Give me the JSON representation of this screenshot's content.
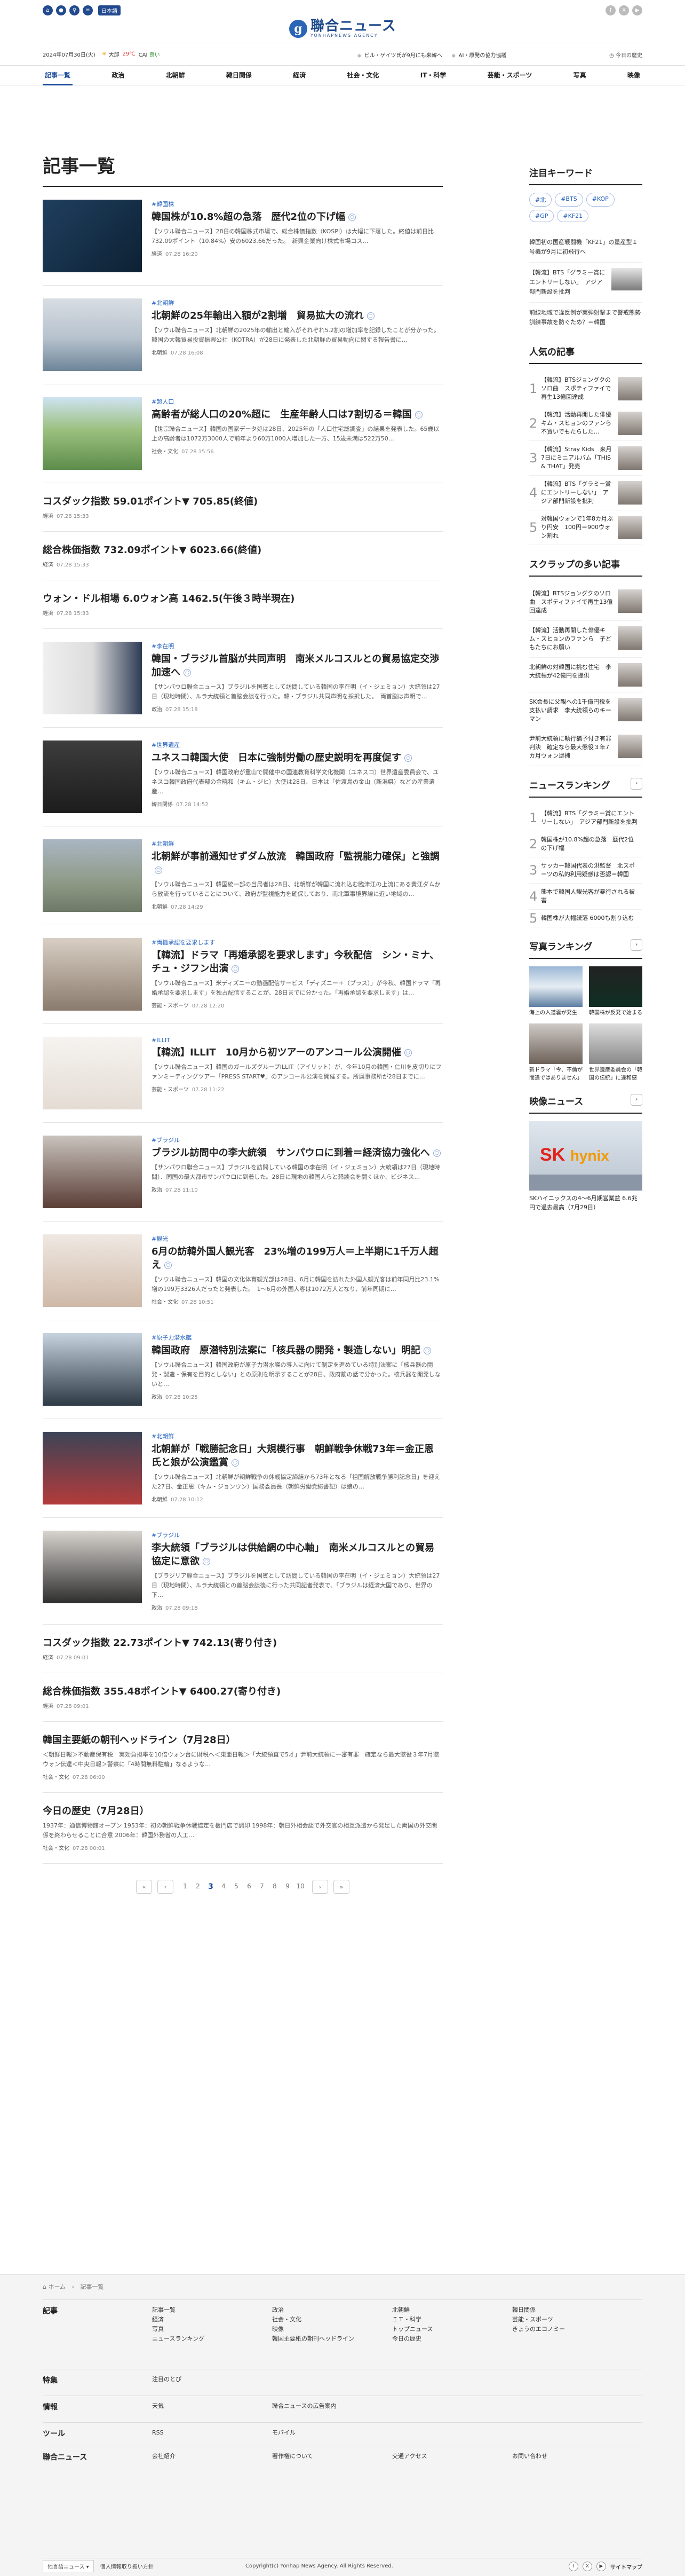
{
  "header": {
    "lang": "日本語",
    "logo_jp": "聯合ニュース",
    "logo_en": "YONHAPNEWS AGENCY",
    "date": "2024年07月30日(火)",
    "weather": "大邱",
    "temp": "29℃",
    "dust_label": "CAI",
    "dust_value": "良い",
    "ticker": [
      "ビル・ゲイツ氏が9月にも来韓へ",
      "AI・原発の協力協議"
    ],
    "history": "今日の歴史"
  },
  "nav": [
    "記事一覧",
    "政治",
    "北朝鮮",
    "韓日関係",
    "経済",
    "社会・文化",
    "IT・科学",
    "芸能・スポーツ",
    "写真",
    "映像"
  ],
  "main": {
    "title": "記事一覧",
    "articles": [
      {
        "cat": "#韓国株",
        "title": "韓国株が10.8%超の急落　歴代2位の下げ幅",
        "summary": "【ソウル聯合ニュース】28日の韓国株式市場で、総合株価指数（KOSPI）は大幅に下落した。終値は前日比732.09ポイント（10.84%）安の6023.66だった。　新興企業向け株式市場コス…",
        "tag": "経済",
        "time": "07.28 16:20",
        "thumb": "stock"
      },
      {
        "cat": "#北朝鮮",
        "title": "北朝鮮の25年輸出入額が2割増　貿易拡大の流れ",
        "summary": "【ソウル聯合ニュース】北朝鮮の2025年の輸出と輸入がそれぞれ5.2割の増加率を記録したことが分かった。　韓国の大韓貿易投資振興公社（KOTRA）が28日に発表した北朝鮮の貿易動向に関する報告書に…",
        "tag": "北朝鮮",
        "time": "07.28 16:08",
        "thumb": "port"
      },
      {
        "cat": "#超人口",
        "title": "高齢者が総人口の20%超に　生産年齢人口は7割切る＝韓国",
        "summary": "【世宗聯合ニュース】韓国の国家データ処は28日、2025年の「人口住宅総調査」の結果を発表した。65歳以上の高齢者は1072万3000人で前年より60万1000人増加した一方、15歳未満は522万50…",
        "tag": "社会・文化",
        "time": "07.28 15:56",
        "thumb": "park"
      }
    ],
    "plain1": [
      {
        "title": "コスダック指数 59.01ポイント▼ 705.85(終値)",
        "tag": "経済",
        "time": "07.28 15:33"
      },
      {
        "title": "総合株価指数 732.09ポイント▼ 6023.66(終値)",
        "tag": "経済",
        "time": "07.28 15:33"
      },
      {
        "title": "ウォン・ドル相場 6.0ウォン高 1462.5(午後３時半現在)",
        "tag": "経済",
        "time": "07.28 15:33"
      }
    ],
    "articles2": [
      {
        "cat": "#李在明",
        "title": "韓国・ブラジル首脳が共同声明　南米メルコスルとの貿易協定交渉加速へ",
        "summary": "【サンパウロ聯合ニュース】ブラジルを国賓として訪問している韓国の李在明（イ・ジェミョン）大統領は27日（現地時間）、ルラ大統領と首脳会談を行った。韓・ブラジル共同声明を採択した。　両首脳は声明で…",
        "tag": "政治",
        "time": "07.28 15:18",
        "thumb": "leaders"
      },
      {
        "cat": "#世界遺産",
        "title": "ユネスコ韓国大使　日本に強制労働の歴史説明を再度促す",
        "summary": "【ソウル聯合ニュース】韓国政府が重山で開催中の国連教育科学文化機関（ユネスコ）世界遺産委員会で、ユネスコ韓国政府代表部の金暁和（キム・ジヒ）大使は28日、日本は「佐渡島の金山（新潟県）などの産業遺産…",
        "tag": "韓日関係",
        "time": "07.28 14:52",
        "thumb": "speaker"
      },
      {
        "cat": "#北朝鮮",
        "title": "北朝鮮が事前通知せずダム放流　韓国政府「監視能力確保」と強調",
        "summary": "【ソウル聯合ニュース】韓国統一部の当局者は28日、北朝鮮が韓国に流れ込む臨津江の上流にある黄江ダムから放流を行っていることについて、政府が監視能力を確保しており、南北軍事境界線に近い地域の…",
        "tag": "北朝鮮",
        "time": "07.28 14:29",
        "thumb": "dam"
      },
      {
        "cat": "#両機承認を要求します",
        "title": "【韓流】ドラマ「再婚承認を要求します」今秋配信　シン・ミナ、チュ・ジフン出演",
        "summary": "【ソウル聯合ニュース】米ディズニーの動画配信サービス「ディズニー＋（プラス）」が今秋、韓国ドラマ「再婚承認を要求します」を独占配信することが、28日までに分かった。「再婚承認を要求します」は…",
        "tag": "芸能・スポーツ",
        "time": "07.28 12:20",
        "thumb": "couple"
      },
      {
        "cat": "#ILLIT",
        "title": "【韓流】ILLIT　10月から初ツアーのアンコール公演開催",
        "summary": "【ソウル聯合ニュース】韓国のガールズグループILLIT（アイリット）が、今年10月の韓国・仁川を皮切りにファンミーティングツアー「PRESS START♥」のアンコール公演を開催する。所属事務所が28日までに…",
        "tag": "芸能・スポーツ",
        "time": "07.28 11:22",
        "thumb": "group"
      },
      {
        "cat": "#ブラジル",
        "title": "ブラジル訪問中の李大統領　サンパウロに到着＝経済協力強化へ",
        "summary": "【サンパウロ聯合ニュース】ブラジルを訪問している韓国の李在明（イ・ジェミョン）大統領は27日（現地時間）、同国の最大都市サンパウロに到着した。28日に現地の韓国人らと懇談会を開くほか、ビジネス…",
        "tag": "政治",
        "time": "07.28 11:10",
        "thumb": "plane"
      },
      {
        "cat": "#観光",
        "title": "6月の訪韓外国人観光客　23%増の199万人＝上半期に1千万人超え",
        "summary": "【ソウル聯合ニュース】韓国の文化体育観光部は28日、6月に韓国を訪れた外国人観光客は前年同月比23.1%増の199万3326人だったと発表した。　1～6月の外国人客は1072万人となり、前年同期に…",
        "tag": "社会・文化",
        "time": "07.28 10:51",
        "thumb": "tourists"
      },
      {
        "cat": "#原子力潜水艦",
        "title": "韓国政府　原潜特別法案に「核兵器の開発・製造しない」明記",
        "summary": "【ソウル聯合ニュース】韓国政府が原子力潜水艦の導入に向けて制定を進めている特別法案に「核兵器の開発・製造・保有を目的としない」との原則を明示することが28日、政府筋の話で分かった。核兵器を開発しないと…",
        "tag": "政治",
        "time": "07.28 10:25",
        "thumb": "sub"
      },
      {
        "cat": "#北朝鮮",
        "title": "北朝鮮が「戦勝記念日」大規模行事　朝鮮戦争休戦73年＝金正恩氏と娘が公演鑑賞",
        "summary": "【ソウル聯合ニュース】北朝鮮が朝鮮戦争の休戦協定締結から73年となる「祖国解放戦争勝利記念日」を迎えた27日、金正恩（キム・ジョンウン）国務委員長（朝鮮労働党総書記）は娘の…",
        "tag": "北朝鮮",
        "time": "07.28 10:12",
        "thumb": "stage"
      },
      {
        "cat": "#ブラジル",
        "title": "李大統領「ブラジルは供給網の中心軸」　南米メルコスルとの貿易協定に意欲",
        "summary": "【ブラジリア聯合ニュース】ブラジルを国賓として訪問している韓国の李在明（イ・ジェミョン）大統領は27日（現地時間）、ルラ大統領との首脳会談後に行った共同記者発表で、「ブラジルは経済大国であり、世界の下…",
        "tag": "政治",
        "time": "07.28 09:18",
        "thumb": "podium"
      }
    ],
    "plain2": [
      {
        "title": "コスダック指数 22.73ポイント▼ 742.13(寄り付き)",
        "tag": "経済",
        "time": "07.28 09:01"
      },
      {
        "title": "総合株価指数 355.48ポイント▼ 6400.27(寄り付き)",
        "tag": "経済",
        "time": "07.28 09:01"
      }
    ],
    "plain3": [
      {
        "title": "韓国主要紙の朝刊ヘッドライン（7月28日）",
        "summary": "＜朝鮮日報＞不動産保有税　実効負担率を10倍ウォン台に財税へ＜東亜日報＞「大統領直で5才」尹前大統領に一審有罪　確定なら最大懲役３年7月懲ウォン伝達＜中央日報＞警察に「4時間無料駐輪」なるような…",
        "tag": "社会・文化",
        "time": "07.28 06:00"
      },
      {
        "title": "今日の歴史（7月28日）",
        "summary": "1937年：通信博物館オープン 1953年：初の朝鮮戦争休戦協定を板門店で調印 1998年：朝日外相会談で外交官の相互派遣から発足した両国の外交関係を終わらせることに合意 2006年：韓国外務省の人工…",
        "tag": "社会・文化",
        "time": "07.28 00:01"
      }
    ],
    "pages": [
      "1",
      "2",
      "3",
      "4",
      "5",
      "6",
      "7",
      "8",
      "9",
      "10"
    ],
    "current_page": "3"
  },
  "side": {
    "kw_title": "注目キーワード",
    "tags": [
      "#北",
      "#BTS",
      "#KOP",
      "#GP",
      "#KF21"
    ],
    "kw_items": [
      {
        "text": "韓国初の国産戦闘機「KF21」の量産型１号機が9月に初飛行へ"
      },
      {
        "text": "【韓流】BTS「グラミー賞にエントリーしない」　アジア部門新設を批判",
        "thumb": "band"
      },
      {
        "text": "前線地域で違反例が実弾射撃まで警戒態勢　訓練事故を防ぐため？＝韓国"
      }
    ],
    "pop_title": "人気の記事",
    "popular": [
      {
        "n": "1",
        "text": "【韓流】BTSジョングクのソロ曲　スポティファイで再生13億回達成"
      },
      {
        "n": "2",
        "text": "【韓流】活動再開した俳優キム・スヒョンのファンら　不買いでもたらした…"
      },
      {
        "n": "3",
        "text": "【韓流】Stray Kids　来月7日にミニアルバム「THIS & THAT」発売"
      },
      {
        "n": "4",
        "text": "【韓流】BTS「グラミー賞にエントリーしない」　アジア部門新設を批判"
      },
      {
        "n": "5",
        "text": "対韓国ウォンで1年8カ月ぶり円安　100円＝900ウォン割れ"
      }
    ],
    "scrap_title": "スクラップの多い記事",
    "scraps": [
      {
        "text": "【韓流】BTSジョングクのソロ曲　スポティファイで再生13億回達成"
      },
      {
        "text": "【韓流】活動再開した俳優キム・スヒョンのファンら　子どもたちにお願い"
      },
      {
        "text": "北朝鮮の対韓国に挑む住宅　李大統領が42億円を提供"
      },
      {
        "text": "SK会長に父親への1千億円税を支払い請求　李大統領らのキーマン"
      },
      {
        "text": "尹前大統領に執行猶予付き有罪判決　確定なら最大懲役３年7カ月ウォン逮捕"
      }
    ],
    "news_title": "ニュースランキング",
    "news": [
      {
        "n": "1",
        "text": "【韓流】BTS「グラミー賞にエントリーしない」　アジア部門新設を批判"
      },
      {
        "n": "2",
        "text": "韓国株が10.8%超の急落　歴代2位の下げ幅"
      },
      {
        "n": "3",
        "text": "サッカー韓国代表の洪監督　北スポーツの私的利用疑惑は否認＝韓国"
      },
      {
        "n": "4",
        "text": "熊本で韓国人観光客が暴行される被害"
      },
      {
        "n": "5",
        "text": "韓国株が大幅続落 6000も割り込む"
      }
    ],
    "photo_title": "写真ランキング",
    "photos": [
      {
        "cap": "海上の入道雲が発生",
        "img": "sea"
      },
      {
        "cap": "韓国株が反発で始まる",
        "img": "board"
      },
      {
        "cap": "新ドラマ「今、不倫が間違ではありません」",
        "img": "drama"
      },
      {
        "cap": "世界遺産委員会の「韓国の伝統」に違和感"
      }
    ],
    "video_title": "映像ニュース",
    "video_cap": "SKハイニックスの4～6月期営業益 6.6兆円で過去最高（7月29日）"
  },
  "footer": {
    "bc_home": "ホーム",
    "bc_cur": "記事一覧",
    "sections": [
      {
        "label": "記事",
        "cols": [
          [
            "記事一覧",
            "経済",
            "写真",
            "ニュースランキング"
          ],
          [
            "政治",
            "社会・文化",
            "映像",
            "韓国主要紙の朝刊ヘッドライン"
          ],
          [
            "北朝鮮",
            "ＩＴ・科学",
            "トップニュース",
            "今日の歴史"
          ],
          [
            "韓日関係",
            "芸能・スポーツ",
            "きょうのエコノミー"
          ]
        ]
      },
      {
        "label": "特集",
        "cols": [
          [
            "注目のとぴ"
          ]
        ]
      },
      {
        "label": "情報",
        "cols": [
          [
            "天気"
          ],
          [
            "聯合ニュースの広告案内"
          ]
        ]
      },
      {
        "label": "ツール",
        "cols": [
          [
            "RSS"
          ],
          [
            "モバイル"
          ]
        ]
      },
      {
        "label": "聯合ニュース",
        "cols": [
          [
            "会社紹介"
          ],
          [
            "著作権について"
          ],
          [
            "交通アクセス"
          ],
          [
            "お問い合わせ"
          ]
        ]
      }
    ],
    "select": "他言語ニュース",
    "privacy": "個人情報取り扱い方針",
    "copyright": "Copyright(c) Yonhap News Agency. All Rights Reserved.",
    "sitemap": "サイトマップ"
  },
  "colors": {
    "accent": "#1a4a9a",
    "link": "#1f5fbf"
  }
}
